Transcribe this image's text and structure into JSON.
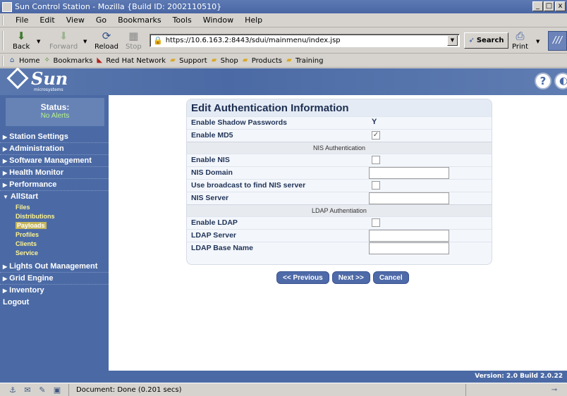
{
  "window": {
    "title": "Sun Control Station - Mozilla {Build ID: 2002110510}",
    "min": "_",
    "max": "□",
    "close": "x"
  },
  "menubar": [
    "File",
    "Edit",
    "View",
    "Go",
    "Bookmarks",
    "Tools",
    "Window",
    "Help"
  ],
  "navbar": {
    "back": "Back",
    "forward": "Forward",
    "reload": "Reload",
    "stop": "Stop",
    "url": "https://10.6.163.2:8443/sdui/mainmenu/index.jsp",
    "search": "Search",
    "print": "Print"
  },
  "bookmarks": [
    "Home",
    "Bookmarks",
    "Red Hat Network",
    "Support",
    "Shop",
    "Products",
    "Training"
  ],
  "banner": {
    "logo": "Sun",
    "logo_sub": "microsystems",
    "help": "?"
  },
  "status": {
    "title": "Status:",
    "value": "No Alerts"
  },
  "nav": {
    "station_settings": "Station Settings",
    "administration": "Administration",
    "software_management": "Software Management",
    "health_monitor": "Health Monitor",
    "performance": "Performance",
    "allstart": "AllStart",
    "sub": [
      "Files",
      "Distributions",
      "Payloads",
      "Profiles",
      "Clients",
      "Service"
    ],
    "selected_sub": "Payloads",
    "lights_out": "Lights Out Management",
    "grid_engine": "Grid Engine",
    "inventory": "Inventory",
    "logout": "Logout"
  },
  "form": {
    "title": "Edit Authentication Information",
    "enable_shadow": "Enable Shadow Passwords",
    "enable_shadow_value": "Y",
    "enable_md5": "Enable MD5",
    "enable_md5_checked": true,
    "nis_section": "NIS Authentication",
    "enable_nis": "Enable NIS",
    "nis_domain": "NIS Domain",
    "nis_domain_value": "",
    "use_broadcast": "Use broadcast to find NIS server",
    "nis_server": "NIS Server",
    "nis_server_value": "",
    "ldap_section": "LDAP Authentiation",
    "enable_ldap": "Enable LDAP",
    "ldap_server": "LDAP Server",
    "ldap_server_value": "",
    "ldap_base": "LDAP Base Name",
    "ldap_base_value": ""
  },
  "buttons": {
    "previous": "<< Previous",
    "next": "Next >>",
    "cancel": "Cancel"
  },
  "version": "Version: 2.0 Build 2.0.22",
  "statusbar": {
    "text": "Document: Done (0.201 secs)"
  },
  "colors": {
    "sun_blue": "#4b6aa5",
    "nav_sub_text": "#fff490",
    "status_ok": "#b6f28a"
  }
}
